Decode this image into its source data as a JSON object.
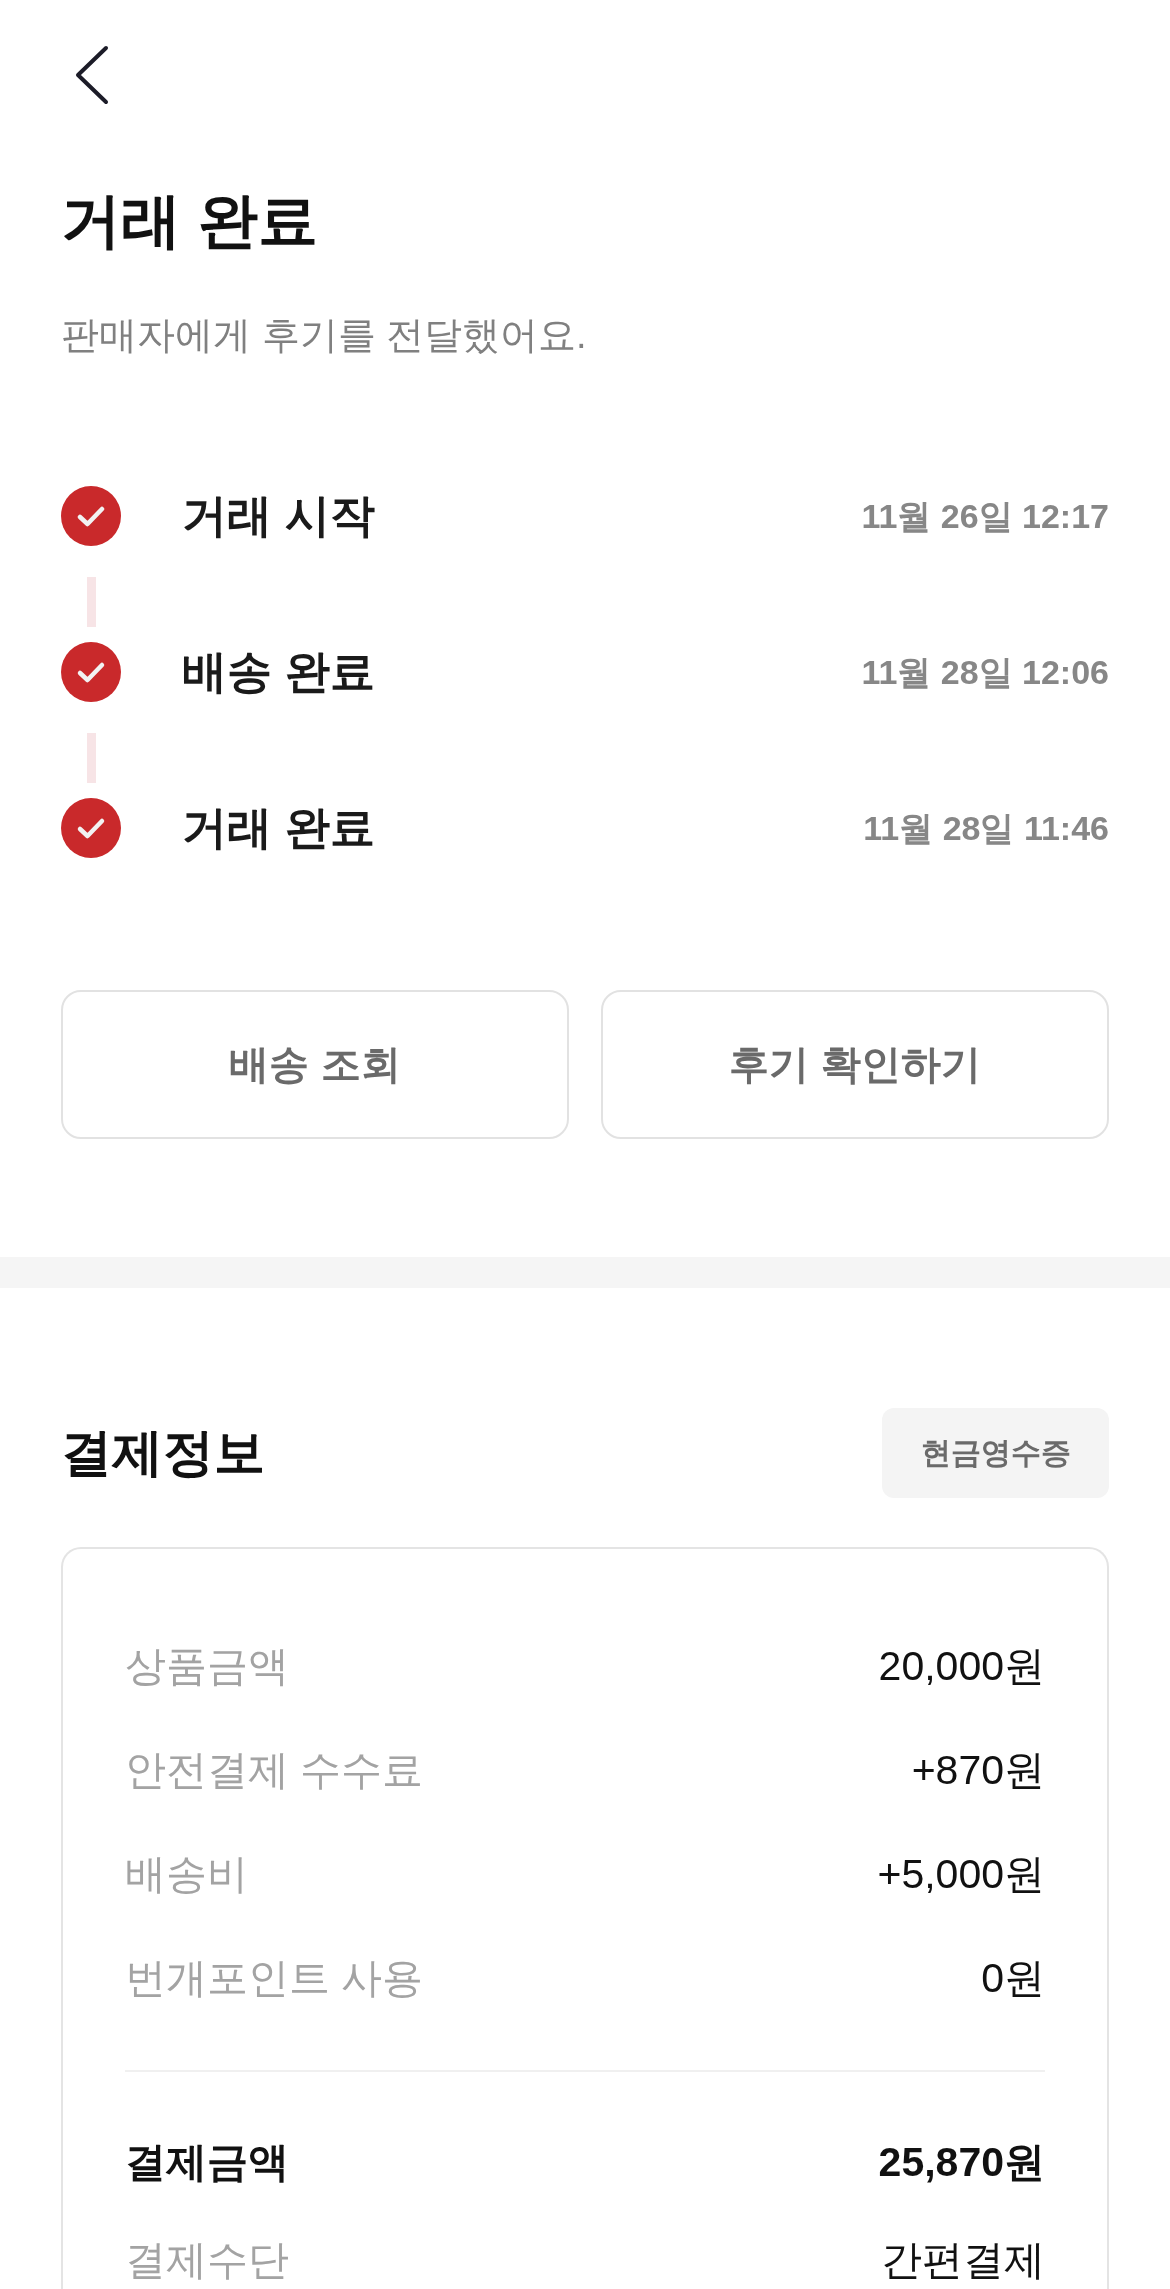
{
  "header": {
    "title": "거래 완료",
    "subtitle": "판매자에게 후기를 전달했어요."
  },
  "timeline": [
    {
      "label": "거래 시작",
      "time": "11월 26일 12:17",
      "done": true
    },
    {
      "label": "배송 완료",
      "time": "11월 28일 12:06",
      "done": true
    },
    {
      "label": "거래 완료",
      "time": "11월 28일 11:46",
      "done": true
    }
  ],
  "actions": [
    "배송 조회",
    "후기 확인하기"
  ],
  "payment": {
    "title": "결제정보",
    "receipt_button": "현금영수증",
    "rows": [
      {
        "label": "상품금액",
        "value": "20,000원",
        "kind": "line"
      },
      {
        "label": "안전결제 수수료",
        "value": "+870원",
        "kind": "line"
      },
      {
        "label": "배송비",
        "value": "+5,000원",
        "kind": "line"
      },
      {
        "label": "번개포인트 사용",
        "value": "0원",
        "kind": "line"
      },
      {
        "label": "결제금액",
        "value": "25,870원",
        "kind": "total"
      },
      {
        "label": "결제수단",
        "value": "간편결제",
        "kind": "method"
      }
    ]
  }
}
